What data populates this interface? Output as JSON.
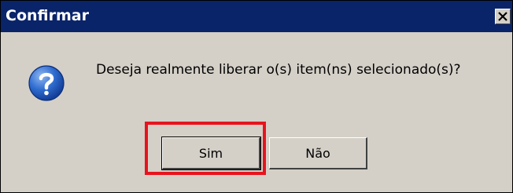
{
  "window": {
    "title": "Confirmar",
    "close_symbol": "×"
  },
  "dialog": {
    "icon": "question-icon",
    "message": "Deseja realmente liberar o(s) item(ns) selecionado(s)?"
  },
  "buttons": {
    "yes_label": "Sim",
    "no_label": "Não"
  },
  "colors": {
    "titlebar": "#0a246a",
    "window_bg": "#d4d0c8",
    "highlight": "#e8131d",
    "icon_blue": "#1c55b8"
  }
}
